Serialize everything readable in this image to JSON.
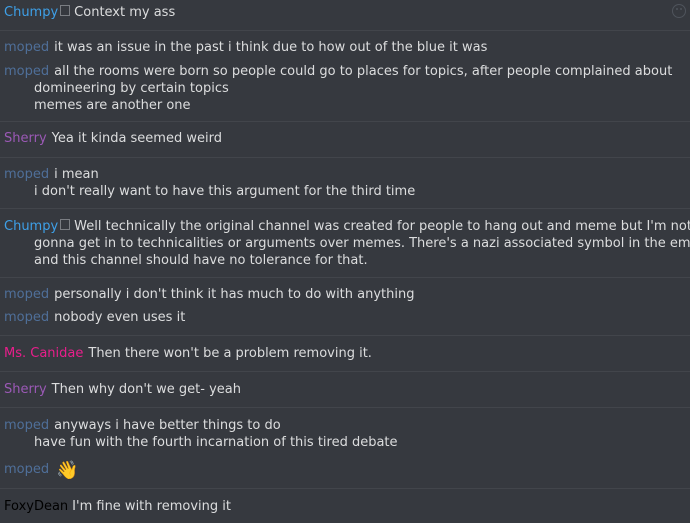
{
  "colors": {
    "background": "#36393f",
    "divider": "#42454b",
    "text": "#dcddde",
    "chumpy": "#3ea0e8",
    "moped": "#4f6f99",
    "sherry": "#9b59b6",
    "ms_canidae": "#e91e8c",
    "foxydean": "#000000"
  },
  "messages": [
    {
      "author": "Chumpy",
      "badge": "□",
      "lines": [
        "Context my ass"
      ]
    },
    {
      "author": "moped",
      "lines": [
        "it was an issue in the past i think due to how out of the blue it was"
      ]
    },
    {
      "author": "moped",
      "lines": [
        "all the rooms were born so people could go to places for topics, after people complained about",
        "domineering by certain topics",
        "memes are another one"
      ]
    },
    {
      "author": "Sherry",
      "lines": [
        "Yea it kinda seemed weird"
      ]
    },
    {
      "author": "moped",
      "lines": [
        "i mean",
        "i don't really want to have this argument for the third time"
      ]
    },
    {
      "author": "Chumpy",
      "badge": "□",
      "lines": [
        "Well technically the original channel was created for people to hang out and meme but I'm not",
        "gonna get in to technicalities or arguments over memes.  There's a nazi associated symbol in the emotes",
        "and this channel should have no tolerance for that."
      ]
    },
    {
      "author": "moped",
      "lines": [
        "personally i don't think it has much to do with anything"
      ]
    },
    {
      "author": "moped",
      "lines": [
        "nobody even uses it"
      ]
    },
    {
      "author": "Ms. Canidae",
      "lines": [
        "Then there won't be a problem removing it."
      ]
    },
    {
      "author": "Sherry",
      "lines": [
        "Then why don't we get- yeah"
      ]
    },
    {
      "author": "moped",
      "lines": [
        "anyways i have better things to do",
        "have fun with the fourth incarnation of this tired debate"
      ]
    },
    {
      "author": "moped",
      "emoji": "👋",
      "emoji_name": "waving-hand-icon"
    },
    {
      "author": "FoxyDean",
      "lines": [
        "I'm fine with removing it"
      ]
    }
  ]
}
